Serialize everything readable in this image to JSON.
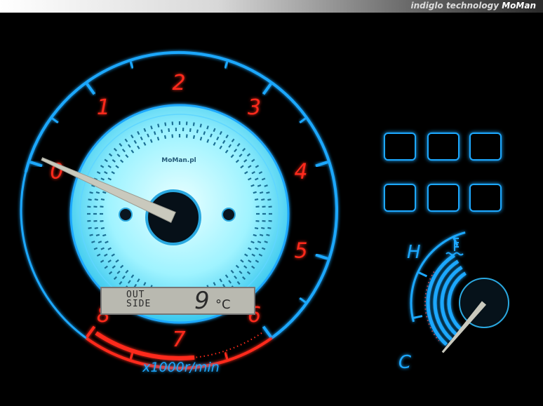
{
  "header": {
    "text": "indiglo technology",
    "brand": "MoMan"
  },
  "gauge": {
    "rpm_labels": [
      "0",
      "1",
      "2",
      "3",
      "4",
      "5",
      "6",
      "7",
      "8"
    ],
    "unit": "x1000r/min",
    "center_brand": "MoMan.pl",
    "needle_value": 0
  },
  "display": {
    "label_line1": "OUT",
    "label_line2": "SIDE",
    "temperature": "9",
    "unit": "°C"
  },
  "temp_gauge": {
    "hot_label": "H",
    "cold_label": "C",
    "level": 0.0
  },
  "warning_lights": [
    {
      "name": "door-ajar-icon",
      "active": true
    },
    {
      "name": "blank",
      "active": false
    },
    {
      "name": "blank",
      "active": false
    },
    {
      "name": "brake-warning-icon",
      "active": true
    },
    {
      "name": "battery-icon",
      "active": true
    },
    {
      "name": "oil-pressure-icon",
      "active": true
    }
  ],
  "colors": {
    "blue": "#1da8ff",
    "red": "#ff2a1a",
    "face": "#bff8ff"
  }
}
